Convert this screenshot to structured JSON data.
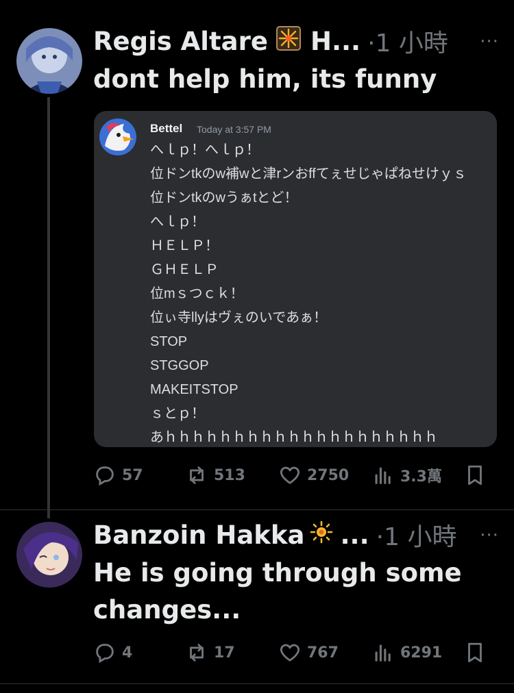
{
  "posts": [
    {
      "author": "Regis Altare",
      "badge_icon": "firework-icon",
      "author_suffix": "H...",
      "time": "·1 小時",
      "more": "···",
      "text": "dont help him, its funny",
      "embed": {
        "name": "Bettel",
        "time": "Today at 3:57 PM",
        "lines": [
          "へｌｐ！へｌｐ！",
          "位ドンtkのw補wと津rンおffてぇせじゃぱねせけｙｓ",
          "位ドンtkのwうぁtとど！",
          "へｌｐ！",
          "ＨＥＬＰ！",
          "ＧＨＥＬＰ",
          "位mｓつｃｋ！",
          "位ぃ寺llyはヴぇのいであぁ！",
          "STOP",
          "STGGOP",
          "MAKEITSTOP",
          "ｓとｐ！",
          "あｈｈｈｈｈｈｈｈｈｈｈｈｈｈｈｈｈｈｈｈ"
        ]
      },
      "actions": {
        "replies": "57",
        "reposts": "513",
        "likes": "2750",
        "views": "3.3萬"
      }
    },
    {
      "author": "Banzoin Hakka",
      "badge_icon": "sun-icon",
      "author_suffix": "...",
      "time": "·1 小時",
      "more": "···",
      "text": "He is going through some changes...",
      "actions": {
        "replies": "4",
        "reposts": "17",
        "likes": "767",
        "views": "6291"
      }
    }
  ],
  "colors": {
    "background": "#000000",
    "muted": "#71767b",
    "embed_bg": "#2b2d31",
    "text": "#e7e9ea"
  }
}
